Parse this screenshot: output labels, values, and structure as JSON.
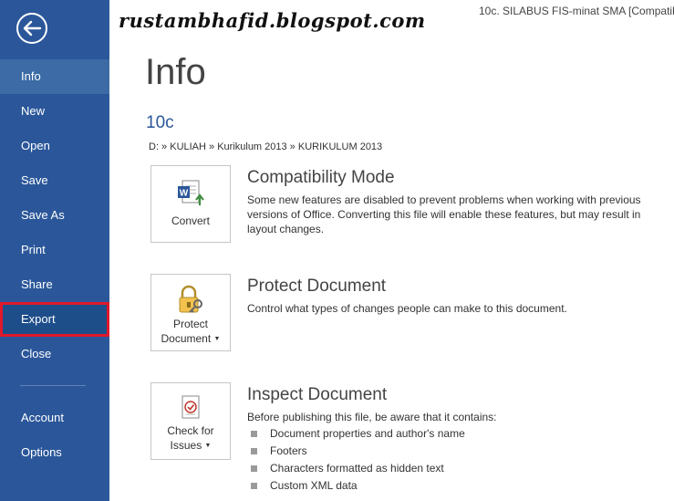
{
  "window": {
    "watermark": "rustambhafid.blogspot.com",
    "title": "10c. SILABUS FIS-minat SMA [Compatibi"
  },
  "sidebar": {
    "items": [
      {
        "label": "Info"
      },
      {
        "label": "New"
      },
      {
        "label": "Open"
      },
      {
        "label": "Save"
      },
      {
        "label": "Save As"
      },
      {
        "label": "Print"
      },
      {
        "label": "Share"
      },
      {
        "label": "Export"
      },
      {
        "label": "Close"
      }
    ],
    "lower_items": [
      {
        "label": "Account"
      },
      {
        "label": "Options"
      }
    ],
    "active": "Info",
    "highlighted": "Export",
    "colors": {
      "background": "#2b579a",
      "highlight_border": "#e1182b"
    }
  },
  "main": {
    "heading": "Info",
    "doc_name": "10c",
    "path": "D: » KULIAH » Kurikulum 2013 » KURIKULUM 2013",
    "sections": [
      {
        "button_label": "Convert",
        "icon": "word-convert-icon",
        "title": "Compatibility Mode",
        "description": "Some new features are disabled to prevent problems when working with previous versions of Office. Converting this file will enable these features, but may result in layout changes."
      },
      {
        "button_label_1": "Protect",
        "button_label_2": "Document",
        "icon": "lock-key-icon",
        "title": "Protect Document",
        "description": "Control what types of changes people can make to this document."
      },
      {
        "button_label_1": "Check for",
        "button_label_2": "Issues",
        "icon": "inspect-document-icon",
        "title": "Inspect Document",
        "description": "Before publishing this file, be aware that it contains:",
        "bullets": [
          "Document properties and author's name",
          "Footers",
          "Characters formatted as hidden text",
          "Custom XML data"
        ]
      }
    ]
  }
}
